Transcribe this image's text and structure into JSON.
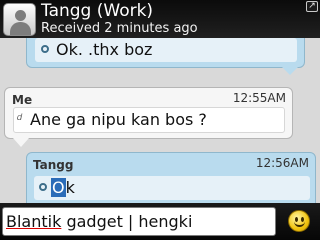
{
  "header": {
    "contact_name": "Tangg (Work)",
    "status": "Received 2 minutes ago",
    "corner_icon": "corner-indicator-icon"
  },
  "messages": [
    {
      "sender": "",
      "time": "",
      "text": "Ok. .thx boz",
      "direction": "incoming"
    },
    {
      "sender": "Me",
      "time": "12:55AM",
      "text": "Ane ga nipu kan bos ?",
      "direction": "outgoing"
    },
    {
      "sender": "Tangg",
      "time": "12:56AM",
      "text_selected": "O",
      "text_rest": "k",
      "direction": "incoming"
    }
  ],
  "composer": {
    "misspelled_word": "Blantik",
    "text_rest": " gadget | hengki",
    "emoticon_icon": "smiley-icon"
  },
  "colors": {
    "incoming_bubble": "#b9dbee",
    "outgoing_bubble": "#f6f6f6",
    "header_bg": "#0b0b0b",
    "selection": "#2b6cb8"
  }
}
